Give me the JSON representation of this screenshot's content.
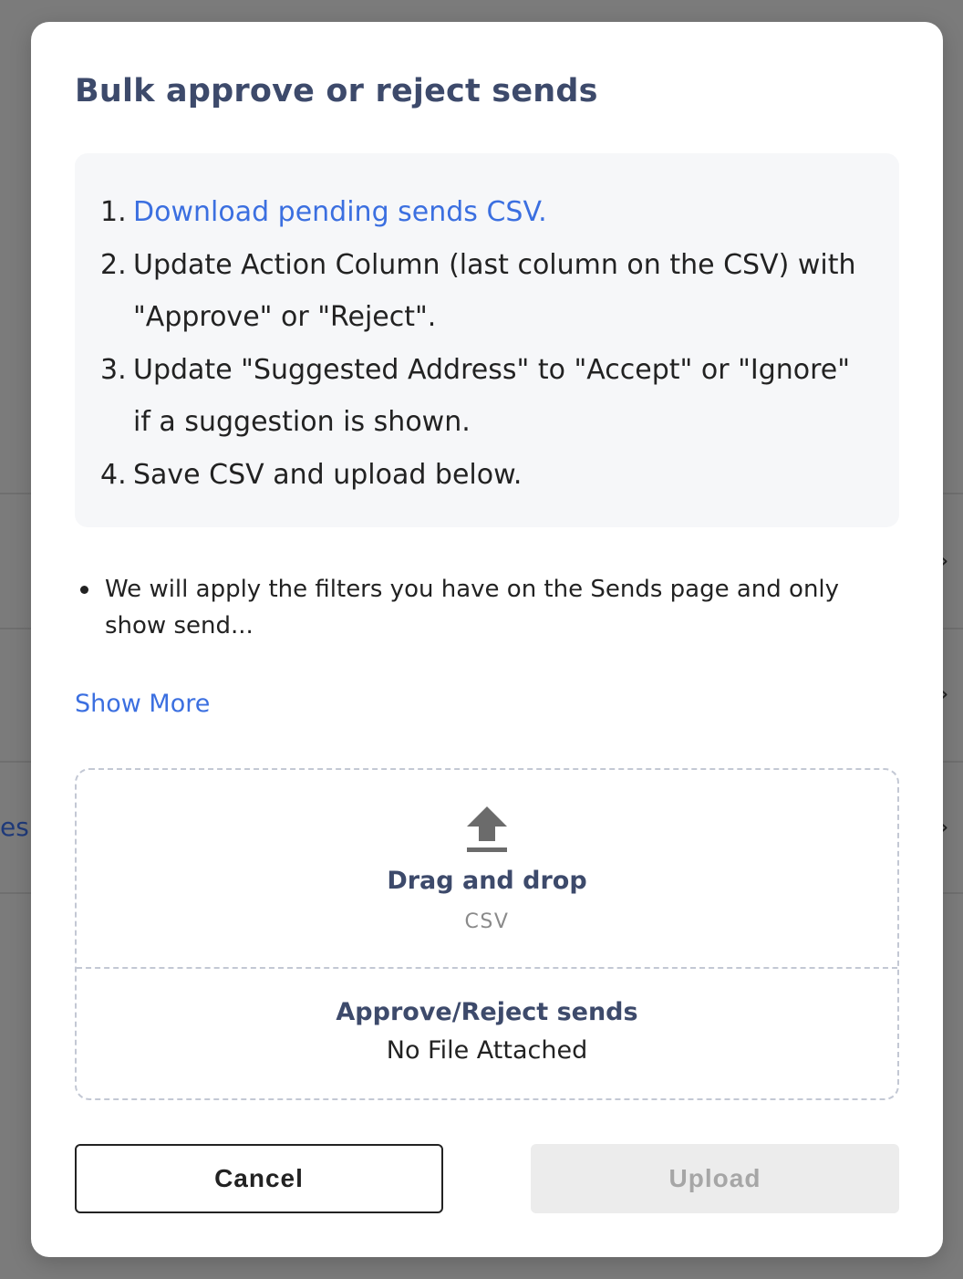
{
  "background": {
    "peek_left_text": "es",
    "peek_right_glyph": "→"
  },
  "modal": {
    "title": "Bulk approve or reject sends",
    "steps": [
      {
        "num": "1.",
        "text": "Download pending sends CSV.",
        "is_link": true
      },
      {
        "num": "2.",
        "text": "Update Action Column (last column on the CSV) with \"Approve\" or \"Reject\".",
        "is_link": false
      },
      {
        "num": "3.",
        "text": "Update \"Suggested Address\" to \"Accept\" or \"Ignore\" if a suggestion is shown.",
        "is_link": false
      },
      {
        "num": "4.",
        "text": "Save CSV and upload below.",
        "is_link": false
      }
    ],
    "note": "We will apply the filters you have on the Sends page and only show send...",
    "show_more_label": "Show More",
    "dropzone": {
      "title": "Drag and drop",
      "file_type": "CSV",
      "target_label": "Approve/Reject sends",
      "status": "No File Attached",
      "icon": "upload-icon"
    },
    "buttons": {
      "cancel_label": "Cancel",
      "upload_label": "Upload"
    }
  },
  "colors": {
    "title": "#3d4a6b",
    "link": "#3b6fe0",
    "overlay": "#7b7b7b",
    "disabled_button_bg": "#ececec",
    "disabled_button_text": "#a6a6a6"
  }
}
